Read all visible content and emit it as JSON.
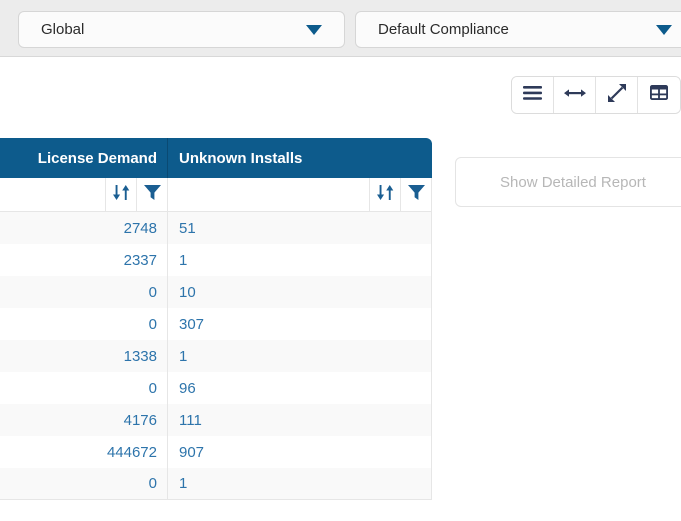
{
  "topbar": {
    "scope_dropdown": {
      "value": "Global",
      "caret_icon": "chevron-down-icon"
    },
    "compliance_dropdown": {
      "value": "Default Compliance",
      "caret_icon": "chevron-down-icon"
    }
  },
  "toolbar": {
    "buttons": [
      {
        "icon": "list-view-icon"
      },
      {
        "icon": "fit-width-icon"
      },
      {
        "icon": "expand-diagonal-icon"
      },
      {
        "icon": "grid-view-icon"
      }
    ]
  },
  "actions": {
    "detailed_report_label": "Show Detailed Report"
  },
  "grid": {
    "columns": [
      {
        "label": "License Demand",
        "align": "right",
        "sort_icon": "sort-icon",
        "filter_icon": "filter-funnel-icon"
      },
      {
        "label": "Unknown Installs",
        "align": "left",
        "sort_icon": "sort-icon",
        "filter_icon": "filter-funnel-icon"
      }
    ],
    "rows": [
      {
        "license_demand": "2748",
        "unknown_installs": "51"
      },
      {
        "license_demand": "2337",
        "unknown_installs": "1"
      },
      {
        "license_demand": "0",
        "unknown_installs": "10"
      },
      {
        "license_demand": "0",
        "unknown_installs": "307"
      },
      {
        "license_demand": "1338",
        "unknown_installs": "1"
      },
      {
        "license_demand": "0",
        "unknown_installs": "96"
      },
      {
        "license_demand": "4176",
        "unknown_installs": "111"
      },
      {
        "license_demand": "444672",
        "unknown_installs": "907"
      },
      {
        "license_demand": "0",
        "unknown_installs": "1"
      }
    ]
  },
  "colors": {
    "header_blue": "#0d5b8c",
    "value_blue": "#2d74ab",
    "topbar_gray": "#ececec",
    "row_alt": "#f9f9f9",
    "icon_navy": "#2e3a59"
  }
}
